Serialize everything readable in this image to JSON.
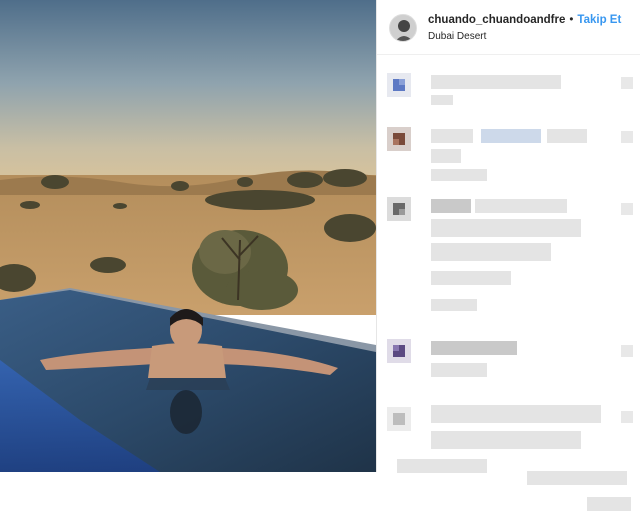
{
  "post": {
    "username": "chuando_chuandoandfre",
    "separator": "•",
    "follow_label": "Takip Et",
    "location": "Dubai Desert"
  },
  "icons": {
    "avatar": "profile-avatar-icon",
    "comment_avatar": "pixelated-avatar-icon",
    "like": "heart-icon"
  },
  "colors": {
    "follow_blue": "#3897f0",
    "text_dark": "#262626",
    "pixelation_gray": "#e4e4e4"
  }
}
